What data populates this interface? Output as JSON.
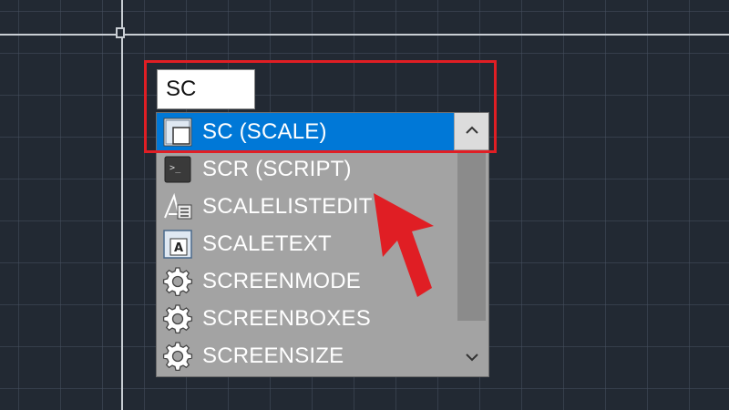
{
  "command_line": {
    "input_value": "SC"
  },
  "autocomplete": {
    "items": [
      {
        "label": "SC (SCALE)",
        "icon": "scale-icon",
        "selected": true
      },
      {
        "label": "SCR (SCRIPT)",
        "icon": "script-icon",
        "selected": false
      },
      {
        "label": "SCALELISTEDIT",
        "icon": "scalelist-icon",
        "selected": false
      },
      {
        "label": "SCALETEXT",
        "icon": "scaletext-icon",
        "selected": false
      },
      {
        "label": "SCREENMODE",
        "icon": "gear-icon",
        "selected": false
      },
      {
        "label": "SCREENBOXES",
        "icon": "gear-icon",
        "selected": false
      },
      {
        "label": "SCREENSIZE",
        "icon": "gear-icon",
        "selected": false
      }
    ],
    "scroll_up_icon": "chevron-up-icon",
    "scroll_down_icon": "chevron-down-icon"
  },
  "colors": {
    "canvas_bg": "#222933",
    "selection": "#0078d7",
    "list_bg": "#a3a3a3",
    "annotation_red": "#e01e24"
  }
}
